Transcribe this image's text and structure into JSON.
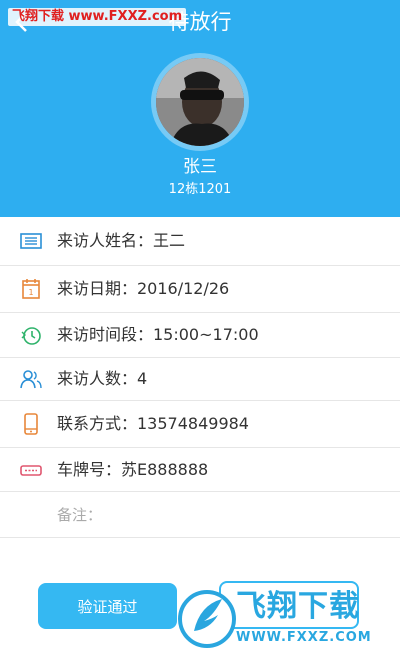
{
  "header": {
    "title": "待放行",
    "watermark": "飞翔下载 www.FXXZ.com",
    "user_name": "张三",
    "user_unit": "12栋1201",
    "bg_color": "#2eaef0"
  },
  "visitor": {
    "name": "来访人姓名：王二",
    "date": "来访日期：2016/12/26",
    "time_slot": "来访时间段：15:00~17:00",
    "count": "来访人数：4",
    "contact": "联系方式：13574849984",
    "plate": "车牌号：苏E888888",
    "notes": "备注："
  },
  "icons": {
    "back": "back-arrow-icon",
    "name": "id-card-icon",
    "date": "calendar-icon",
    "time": "clock-icon",
    "count": "people-icon",
    "contact": "phone-icon",
    "plate": "license-plate-icon"
  },
  "actions": {
    "verify_label": "验证通过",
    "accent": "#35b8f2"
  },
  "footer_watermark": {
    "brand": "飞翔下载",
    "url": "WWW.FXXZ.COM"
  }
}
